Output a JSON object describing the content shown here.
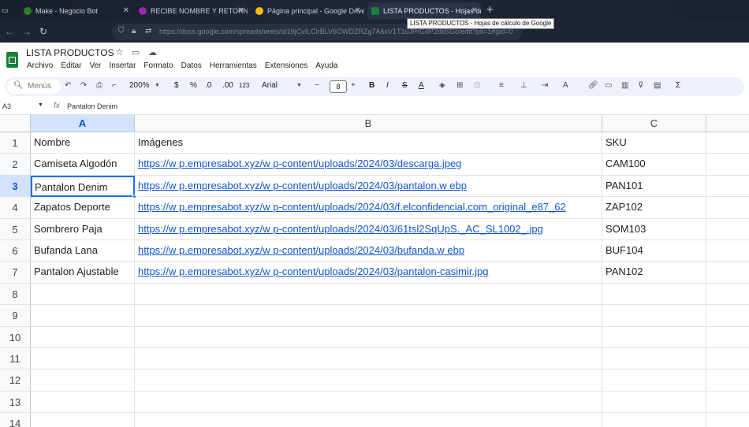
{
  "browser": {
    "tabs": [
      {
        "title": "Make - Negocio Bot",
        "icon_color": "#2e7d32"
      },
      {
        "title": "RECIBE NOMBRE Y RETORNA U",
        "icon_color": "#9c27b0"
      },
      {
        "title": "Página principal - Google Drive",
        "icon_color": "#fbbc04"
      },
      {
        "title": "LISTA PRODUCTOS - Hojas de",
        "icon_color": "#188038"
      }
    ],
    "tooltip": "LISTA PRODUCTOS - Hojas de cálculo de Google",
    "url": "https://docs.google.com/spreadsheets/d/19jCvILClrBLV6OWDZRZg7A6xV1T1uJPrGdP2diiSGo/edit?pli=1#gid=0"
  },
  "sheet": {
    "title": "LISTA PRODUCTOS",
    "menus": [
      "Archivo",
      "Editar",
      "Ver",
      "Insertar",
      "Formato",
      "Datos",
      "Herramientas",
      "Extensiones",
      "Ayuda"
    ],
    "toolbar": {
      "search_label": "Menús",
      "zoom": "200%",
      "currency": "$",
      "percent": "%",
      "dec_less": ".0",
      "dec_more": ".00",
      "num_format": "123",
      "font": "Arial",
      "font_size": "8",
      "bold": "B",
      "italic": "I",
      "sigma": "Σ"
    },
    "name_box": "A3",
    "formula_value": "Pantalon Denim",
    "columns": [
      "A",
      "B",
      "C"
    ],
    "rows": [
      "1",
      "2",
      "3",
      "4",
      "5",
      "6",
      "7",
      "8",
      "9",
      "10",
      "11",
      "12",
      "13",
      "14"
    ],
    "data": [
      [
        "Nombre",
        "Imágenes",
        "SKU"
      ],
      [
        "Camiseta Algodón",
        "https://w p.empresabot.xyz/w p-content/uploads/2024/03/descarga.jpeg",
        "CAM100"
      ],
      [
        "Pantalon Denim",
        "https://w p.empresabot.xyz/w p-content/uploads/2024/03/pantalon.w ebp",
        "PAN101"
      ],
      [
        "Zapatos Deporte",
        "https://w p.empresabot.xyz/w p-content/uploads/2024/03/f.elconfidencial.com_original_e87_62",
        "ZAP102"
      ],
      [
        "Sombrero Paja",
        "https://w p.empresabot.xyz/w p-content/uploads/2024/03/61tsl2SqUpS._AC_SL1002_.jpg",
        "SOM103"
      ],
      [
        "Bufanda Lana",
        "https://w p.empresabot.xyz/w p-content/uploads/2024/03/bufanda.w ebp",
        "BUF104"
      ],
      [
        "Pantalon Ajustable",
        "https://w p.empresabot.xyz/w p-content/uploads/2024/03/pantalon-casimir.jpg",
        "PAN102"
      ]
    ],
    "selected_row": "3",
    "selected_col": "A"
  }
}
